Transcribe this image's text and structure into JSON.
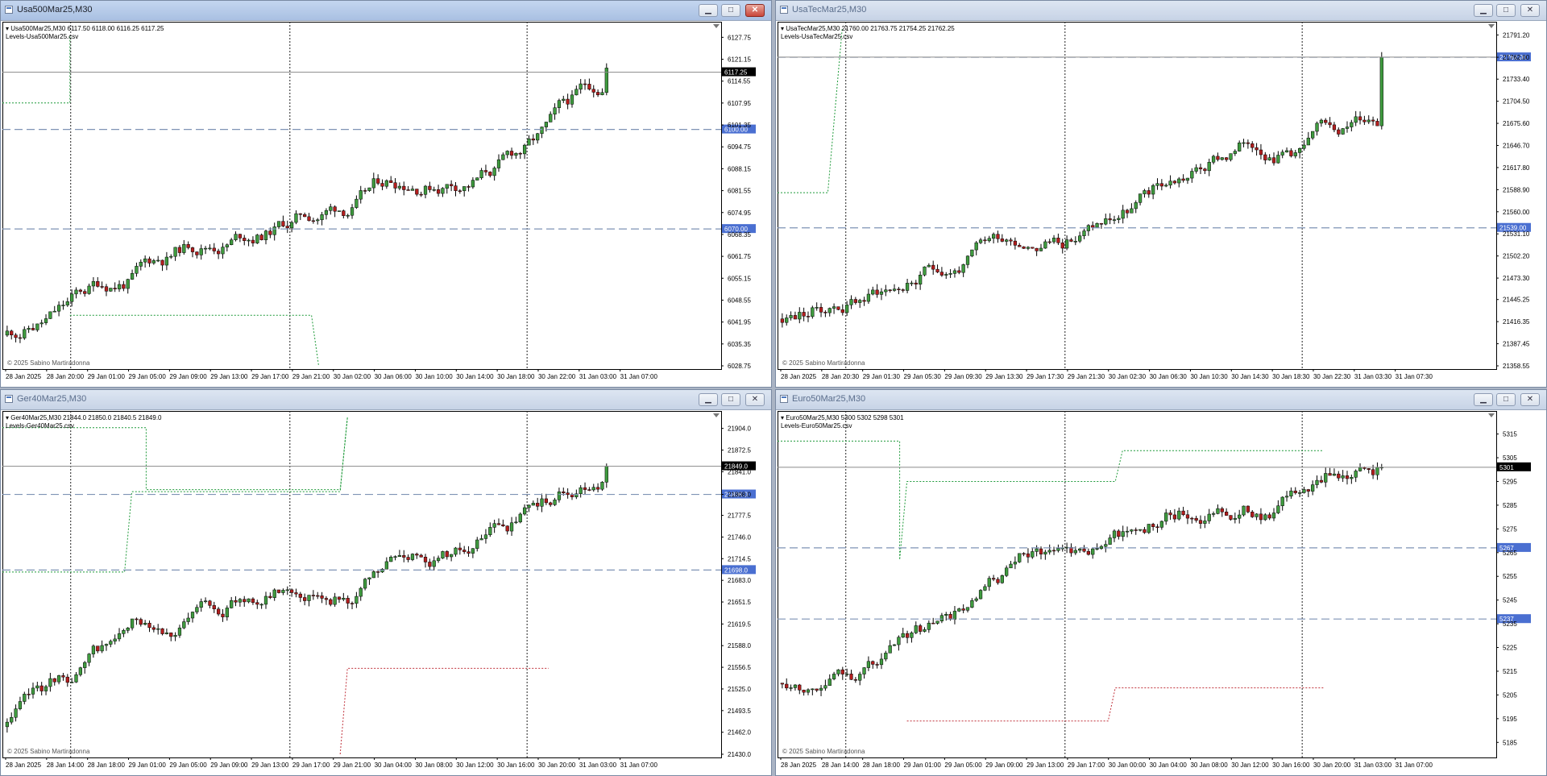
{
  "colors": {
    "bull": "#3f9b3f",
    "bear": "#b41e1e",
    "level_line": "#7f93b5",
    "grid": "#222222",
    "price_line": "#8a8a8a",
    "level_label": "#4a6fd1",
    "current_label": "#000000",
    "upper_band": "#1f9a3a",
    "lower_band": "#c0303a"
  },
  "windows": [
    {
      "id": "usa500",
      "title": "Usa500Mar25,M30",
      "active": true,
      "info": {
        "line1": "Usa500Mar25,M30  6117.50 6118.00 6116.25 6117.25",
        "line2": "Levels-Usa500Mar25.csv"
      },
      "copyright": "© 2025 Sabino Martiradonna",
      "y_axis": {
        "min": 6028.75,
        "max": 6130.5,
        "ticks": [
          "6127.75",
          "6121.15",
          "6114.55",
          "6107.95",
          "6101.35",
          "6094.75",
          "6088.15",
          "6081.55",
          "6074.95",
          "6068.35",
          "6061.75",
          "6055.15",
          "6048.55",
          "6041.95",
          "6035.35",
          "6028.75"
        ]
      },
      "x_ticks": [
        "28 Jan 2025",
        "28 Jan 20:00",
        "29 Jan 01:00",
        "29 Jan 05:00",
        "29 Jan 09:00",
        "29 Jan 13:00",
        "29 Jan 17:00",
        "29 Jan 21:00",
        "30 Jan 02:00",
        "30 Jan 06:00",
        "30 Jan 10:00",
        "30 Jan 14:00",
        "30 Jan 18:00",
        "30 Jan 22:00",
        "31 Jan 03:00",
        "31 Jan 07:00"
      ],
      "levels": [
        {
          "label": "6100.00",
          "value": 6100
        },
        {
          "label": "6070.00",
          "value": 6070
        }
      ],
      "current": {
        "label": "6117.25",
        "value": 6117.25
      },
      "upper_band": [
        [
          0,
          6108
        ],
        [
          0.094,
          6108
        ],
        [
          0.094,
          6128
        ]
      ],
      "lower_band": [
        [
          0.094,
          6044
        ],
        [
          0.43,
          6044
        ],
        [
          0.44,
          6028.75
        ]
      ],
      "start": 6038,
      "end": 6118.5,
      "seed": 11
    },
    {
      "id": "usatec",
      "title": "UsaTecMar25,M30",
      "active": false,
      "info": {
        "line1": "UsaTecMar25,M30  21760.00 21763.75 21754.25 21762.25",
        "line2": "Levels-UsaTecMar25.csv"
      },
      "copyright": "© 2025 Sabino Martiradonna",
      "y_axis": {
        "min": 21358.55,
        "max": 21800,
        "ticks": [
          "21791.20",
          "21762.00",
          "21733.40",
          "21704.50",
          "21675.60",
          "21646.70",
          "21617.80",
          "21588.90",
          "21560.00",
          "21531.10",
          "21502.20",
          "21473.30",
          "21445.25",
          "21416.35",
          "21387.45",
          "21358.55"
        ]
      },
      "x_ticks": [
        "28 Jan 2025",
        "28 Jan 20:30",
        "29 Jan 01:30",
        "29 Jan 05:30",
        "29 Jan 09:30",
        "29 Jan 13:30",
        "29 Jan 17:30",
        "29 Jan 21:30",
        "30 Jan 02:30",
        "30 Jan 06:30",
        "30 Jan 10:30",
        "30 Jan 14:30",
        "30 Jan 18:30",
        "30 Jan 22:30",
        "31 Jan 03:30",
        "31 Jan 07:30"
      ],
      "levels": [
        {
          "label": "21762.00",
          "value": 21762
        },
        {
          "label": "21539.00",
          "value": 21539
        }
      ],
      "current": {
        "label": "",
        "value": 21762.25
      },
      "upper_band": [
        [
          0,
          21585
        ],
        [
          0.07,
          21585
        ],
        [
          0.09,
          21800
        ]
      ],
      "lower_band": [],
      "start": 21420,
      "end": 21762,
      "seed": 23
    },
    {
      "id": "ger40",
      "title": "Ger40Mar25,M30",
      "active": false,
      "info": {
        "line1": "Ger40Mar25,M30  21844.0 21850.0 21840.5 21849.0",
        "line2": "Levels-Ger40Mar25.csv"
      },
      "copyright": "© 2025 Sabino Martiradonna",
      "y_axis": {
        "min": 21430,
        "max": 21920,
        "ticks": [
          "21904.0",
          "21872.5",
          "21841.0",
          "21808.0",
          "21777.5",
          "21746.0",
          "21714.5",
          "21683.0",
          "21651.5",
          "21619.5",
          "21588.0",
          "21556.5",
          "21525.0",
          "21493.5",
          "21462.0",
          "21430.0"
        ]
      },
      "x_ticks": [
        "28 Jan 2025",
        "28 Jan 14:00",
        "28 Jan 18:00",
        "29 Jan 01:00",
        "29 Jan 05:00",
        "29 Jan 09:00",
        "29 Jan 13:00",
        "29 Jan 17:00",
        "29 Jan 21:00",
        "30 Jan 04:00",
        "30 Jan 08:00",
        "30 Jan 12:00",
        "30 Jan 16:00",
        "30 Jan 20:00",
        "31 Jan 03:00",
        "31 Jan 07:00"
      ],
      "levels": [
        {
          "label": "21808.0",
          "value": 21808
        },
        {
          "label": "21698.0",
          "value": 21698
        }
      ],
      "current": {
        "label": "21849.0",
        "value": 21849
      },
      "upper_band": [
        [
          0,
          21905
        ],
        [
          0.2,
          21905
        ],
        [
          0.2,
          21815
        ],
        [
          0.47,
          21815
        ],
        [
          0.48,
          21920
        ]
      ],
      "lower_band": [
        [
          0,
          21695
        ],
        [
          0.17,
          21695
        ],
        [
          0.18,
          21812
        ],
        [
          0.47,
          21812
        ],
        [
          0.48,
          21920
        ]
      ],
      "red_band": [
        [
          0.47,
          21430
        ],
        [
          0.48,
          21555
        ],
        [
          0.76,
          21555
        ]
      ],
      "start": 21470,
      "end": 21849,
      "seed": 37
    },
    {
      "id": "euro50",
      "title": "Euro50Mar25,M30",
      "active": false,
      "info": {
        "line1": "Euro50Mar25,M30  5300 5302 5298 5301",
        "line2": "Levels-Euro50Mar25.csv"
      },
      "copyright": "© 2025 Sabino Martiradonna",
      "y_axis": {
        "min": 5180,
        "max": 5322,
        "ticks": [
          "5315",
          "5305",
          "5295",
          "5285",
          "5275",
          "5265",
          "5255",
          "5245",
          "5235",
          "5225",
          "5215",
          "5205",
          "5195",
          "5185"
        ]
      },
      "x_ticks": [
        "28 Jan 2025",
        "28 Jan 14:00",
        "28 Jan 18:00",
        "29 Jan 01:00",
        "29 Jan 05:00",
        "29 Jan 09:00",
        "29 Jan 13:00",
        "29 Jan 17:00",
        "30 Jan 00:00",
        "30 Jan 04:00",
        "30 Jan 08:00",
        "30 Jan 12:00",
        "30 Jan 16:00",
        "30 Jan 20:00",
        "31 Jan 03:00",
        "31 Jan 07:00"
      ],
      "levels": [
        {
          "label": "5267",
          "value": 5267
        },
        {
          "label": "5237",
          "value": 5237
        }
      ],
      "current": {
        "label": "5301",
        "value": 5301
      },
      "upper_band": [
        [
          0,
          5312
        ],
        [
          0.17,
          5312
        ],
        [
          0.17,
          5262
        ],
        [
          0.17,
          5262
        ],
        [
          0.18,
          5295
        ],
        [
          0.47,
          5295
        ],
        [
          0.48,
          5308
        ],
        [
          0.76,
          5308
        ]
      ],
      "lower_band": [],
      "red_band": [
        [
          0.18,
          5194
        ],
        [
          0.46,
          5194
        ],
        [
          0.47,
          5208
        ],
        [
          0.76,
          5208
        ]
      ],
      "start": 5210,
      "end": 5301,
      "seed": 53
    }
  ]
}
